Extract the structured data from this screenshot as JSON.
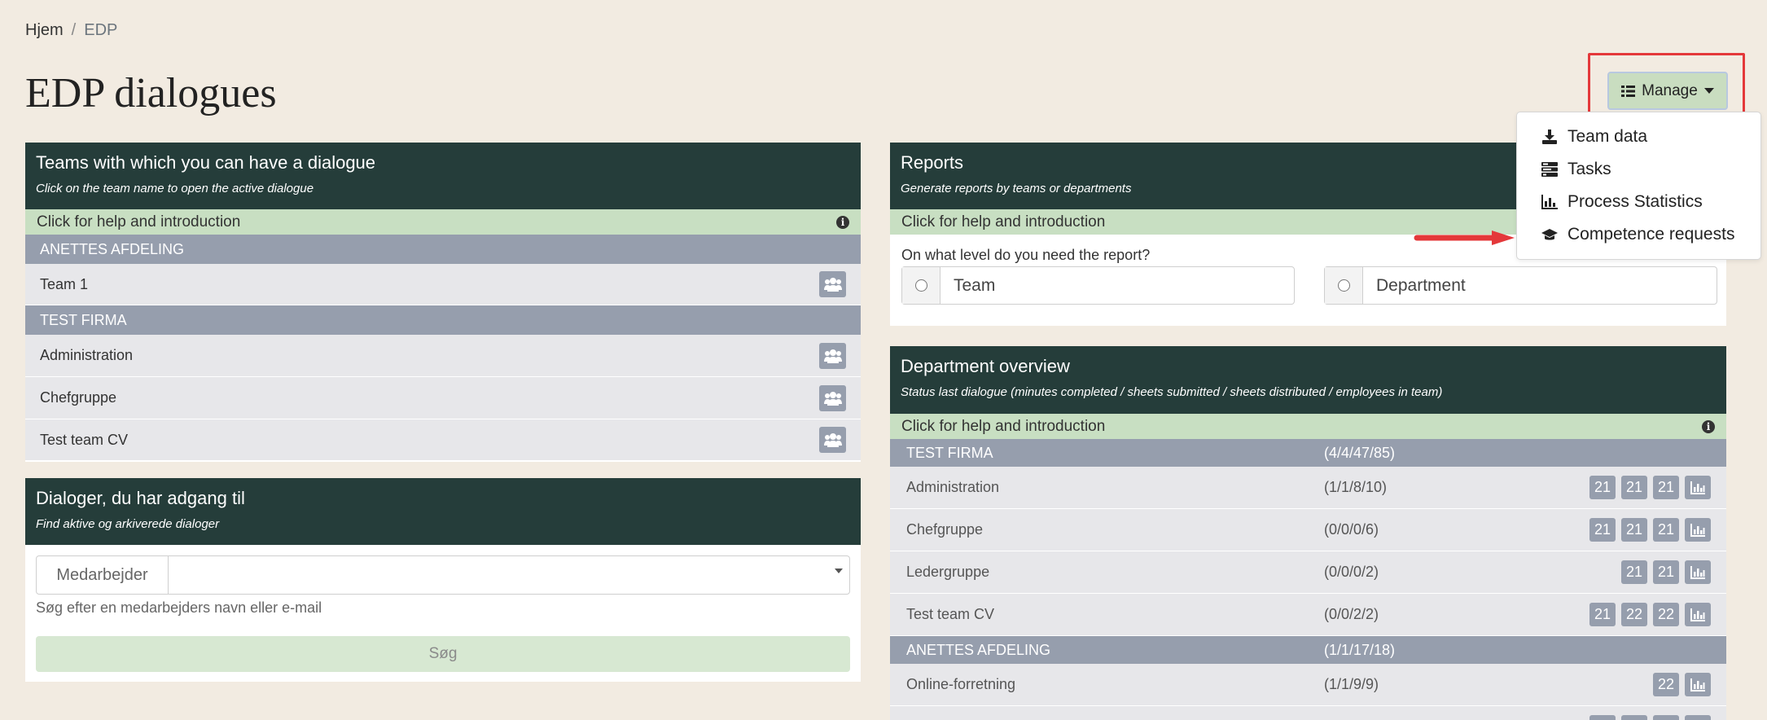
{
  "breadcrumb": {
    "home": "Hjem",
    "separator": "/",
    "current": "EDP"
  },
  "page": {
    "title": "EDP dialogues"
  },
  "manage": {
    "label": "Manage",
    "menu": [
      {
        "label": "Team data",
        "icon": "download-icon"
      },
      {
        "label": "Tasks",
        "icon": "tasks-icon"
      },
      {
        "label": "Process Statistics",
        "icon": "bar-chart-icon"
      },
      {
        "label": "Competence requests",
        "icon": "graduation-cap-icon"
      }
    ]
  },
  "teams": {
    "title": "Teams with which you can have a dialogue",
    "subtitle": "Click on the team name to open the active dialogue",
    "help": "Click for help and introduction",
    "groups": [
      {
        "name": "ANETTES AFDELING",
        "teams": [
          "Team 1"
        ]
      },
      {
        "name": "TEST FIRMA",
        "teams": [
          "Administration",
          "Chefgruppe",
          "Test team CV"
        ]
      }
    ]
  },
  "dialoger": {
    "title": "Dialoger, du har adgang til",
    "subtitle": "Find aktive og arkiverede dialoger",
    "prefix": "Medarbejder",
    "hint": "Søg efter en medarbejders navn eller e-mail",
    "button": "Søg"
  },
  "reports": {
    "title": "Reports",
    "subtitle": "Generate reports by teams or departments",
    "help": "Click for help and introduction",
    "question": "On what level do you need the report?",
    "options": [
      "Team",
      "Department"
    ]
  },
  "dept": {
    "title": "Department overview",
    "subtitle": "Status last dialogue (minutes completed / sheets submitted / sheets distributed / employees in team)",
    "help": "Click for help and introduction",
    "groups": [
      {
        "name": "TEST FIRMA",
        "stat": "(4/4/47/85)",
        "rows": [
          {
            "name": "Administration",
            "stat": "(1/1/8/10)",
            "badges": [
              "21",
              "21",
              "21"
            ]
          },
          {
            "name": "Chefgruppe",
            "stat": "(0/0/0/6)",
            "badges": [
              "21",
              "21",
              "21"
            ]
          },
          {
            "name": "Ledergruppe",
            "stat": "(0/0/0/2)",
            "badges": [
              "21",
              "21"
            ]
          },
          {
            "name": "Test team CV",
            "stat": "(0/0/2/2)",
            "badges": [
              "21",
              "22",
              "22"
            ]
          }
        ]
      },
      {
        "name": "ANETTES AFDELING",
        "stat": "(1/1/17/18)",
        "rows": [
          {
            "name": "Online-forretning",
            "stat": "(1/1/9/9)",
            "badges": [
              "22"
            ]
          },
          {
            "name": "",
            "stat": "",
            "badges": [
              "",
              "",
              ""
            ]
          }
        ]
      }
    ]
  },
  "colors": {
    "background": "#f2ebe1",
    "panel_header": "#253d3a",
    "help_bar": "#c8dfc2",
    "group_header": "#969ead",
    "highlight": "#e4383a"
  }
}
